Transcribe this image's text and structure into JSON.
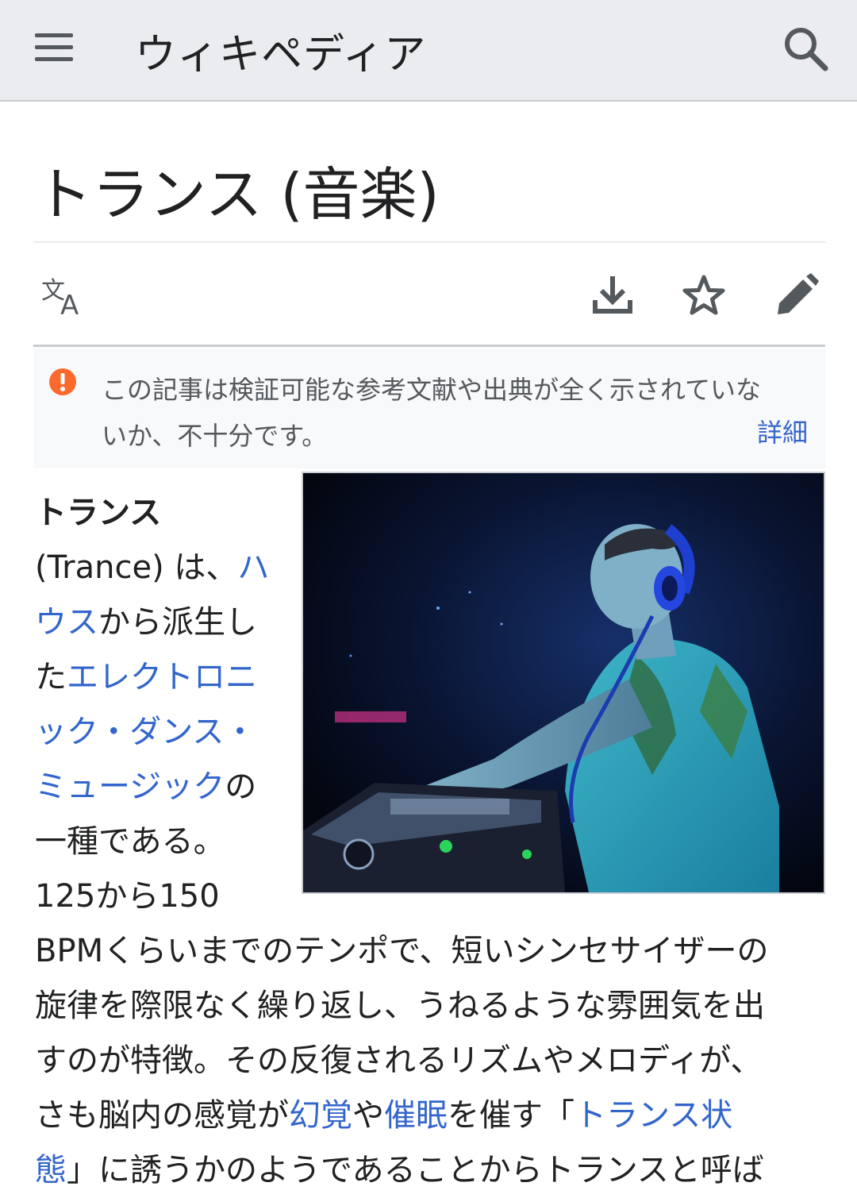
{
  "header": {
    "wordmark": "ウィキペディア"
  },
  "article": {
    "title": "トランス (音楽)"
  },
  "notice": {
    "line1": "この記事は検証可能な参考文献や出典が全く示されていな",
    "line2": "いか、不十分です。",
    "more_link": "詳細"
  },
  "lead": {
    "bold_term": "トランス",
    "l2_a": "(Trance) は、",
    "l2_link": "ハ",
    "l3_link": "ウス",
    "l3_b": "から派生し",
    "l4_a": "た",
    "l4_link": "エレクトロニ",
    "l5_link": "ック・ダンス・",
    "l6_link": "ミュージック",
    "l6_b": "の",
    "l7": "一種である。",
    "l8": "125から150",
    "l9": "BPMくらいまでのテンポで、短いシンセサイザーの",
    "l10": "旋律を際限なく繰り返し、うねるような雰囲気を出",
    "l11": "すのが特徴。その反復されるリズムやメロディが、",
    "l12_a": "さも脳内の感覚が",
    "l12_link1": "幻覚",
    "l12_b": "や",
    "l12_link2": "催眠",
    "l12_c": "を催す「",
    "l12_link3": "トランス状",
    "l13_link": "態",
    "l13_b": "」に誘うかのようであることからトランスと呼ば"
  },
  "icons": {
    "menu": "hamburger-icon",
    "search": "search-icon",
    "language": "translate-icon",
    "download": "download-icon",
    "watch": "star-icon",
    "edit": "pencil-icon",
    "notice": "alert-icon"
  },
  "colors": {
    "link": "#3366cc",
    "notice_icon": "#fc6a2b",
    "header_bg": "#eaecf0"
  }
}
